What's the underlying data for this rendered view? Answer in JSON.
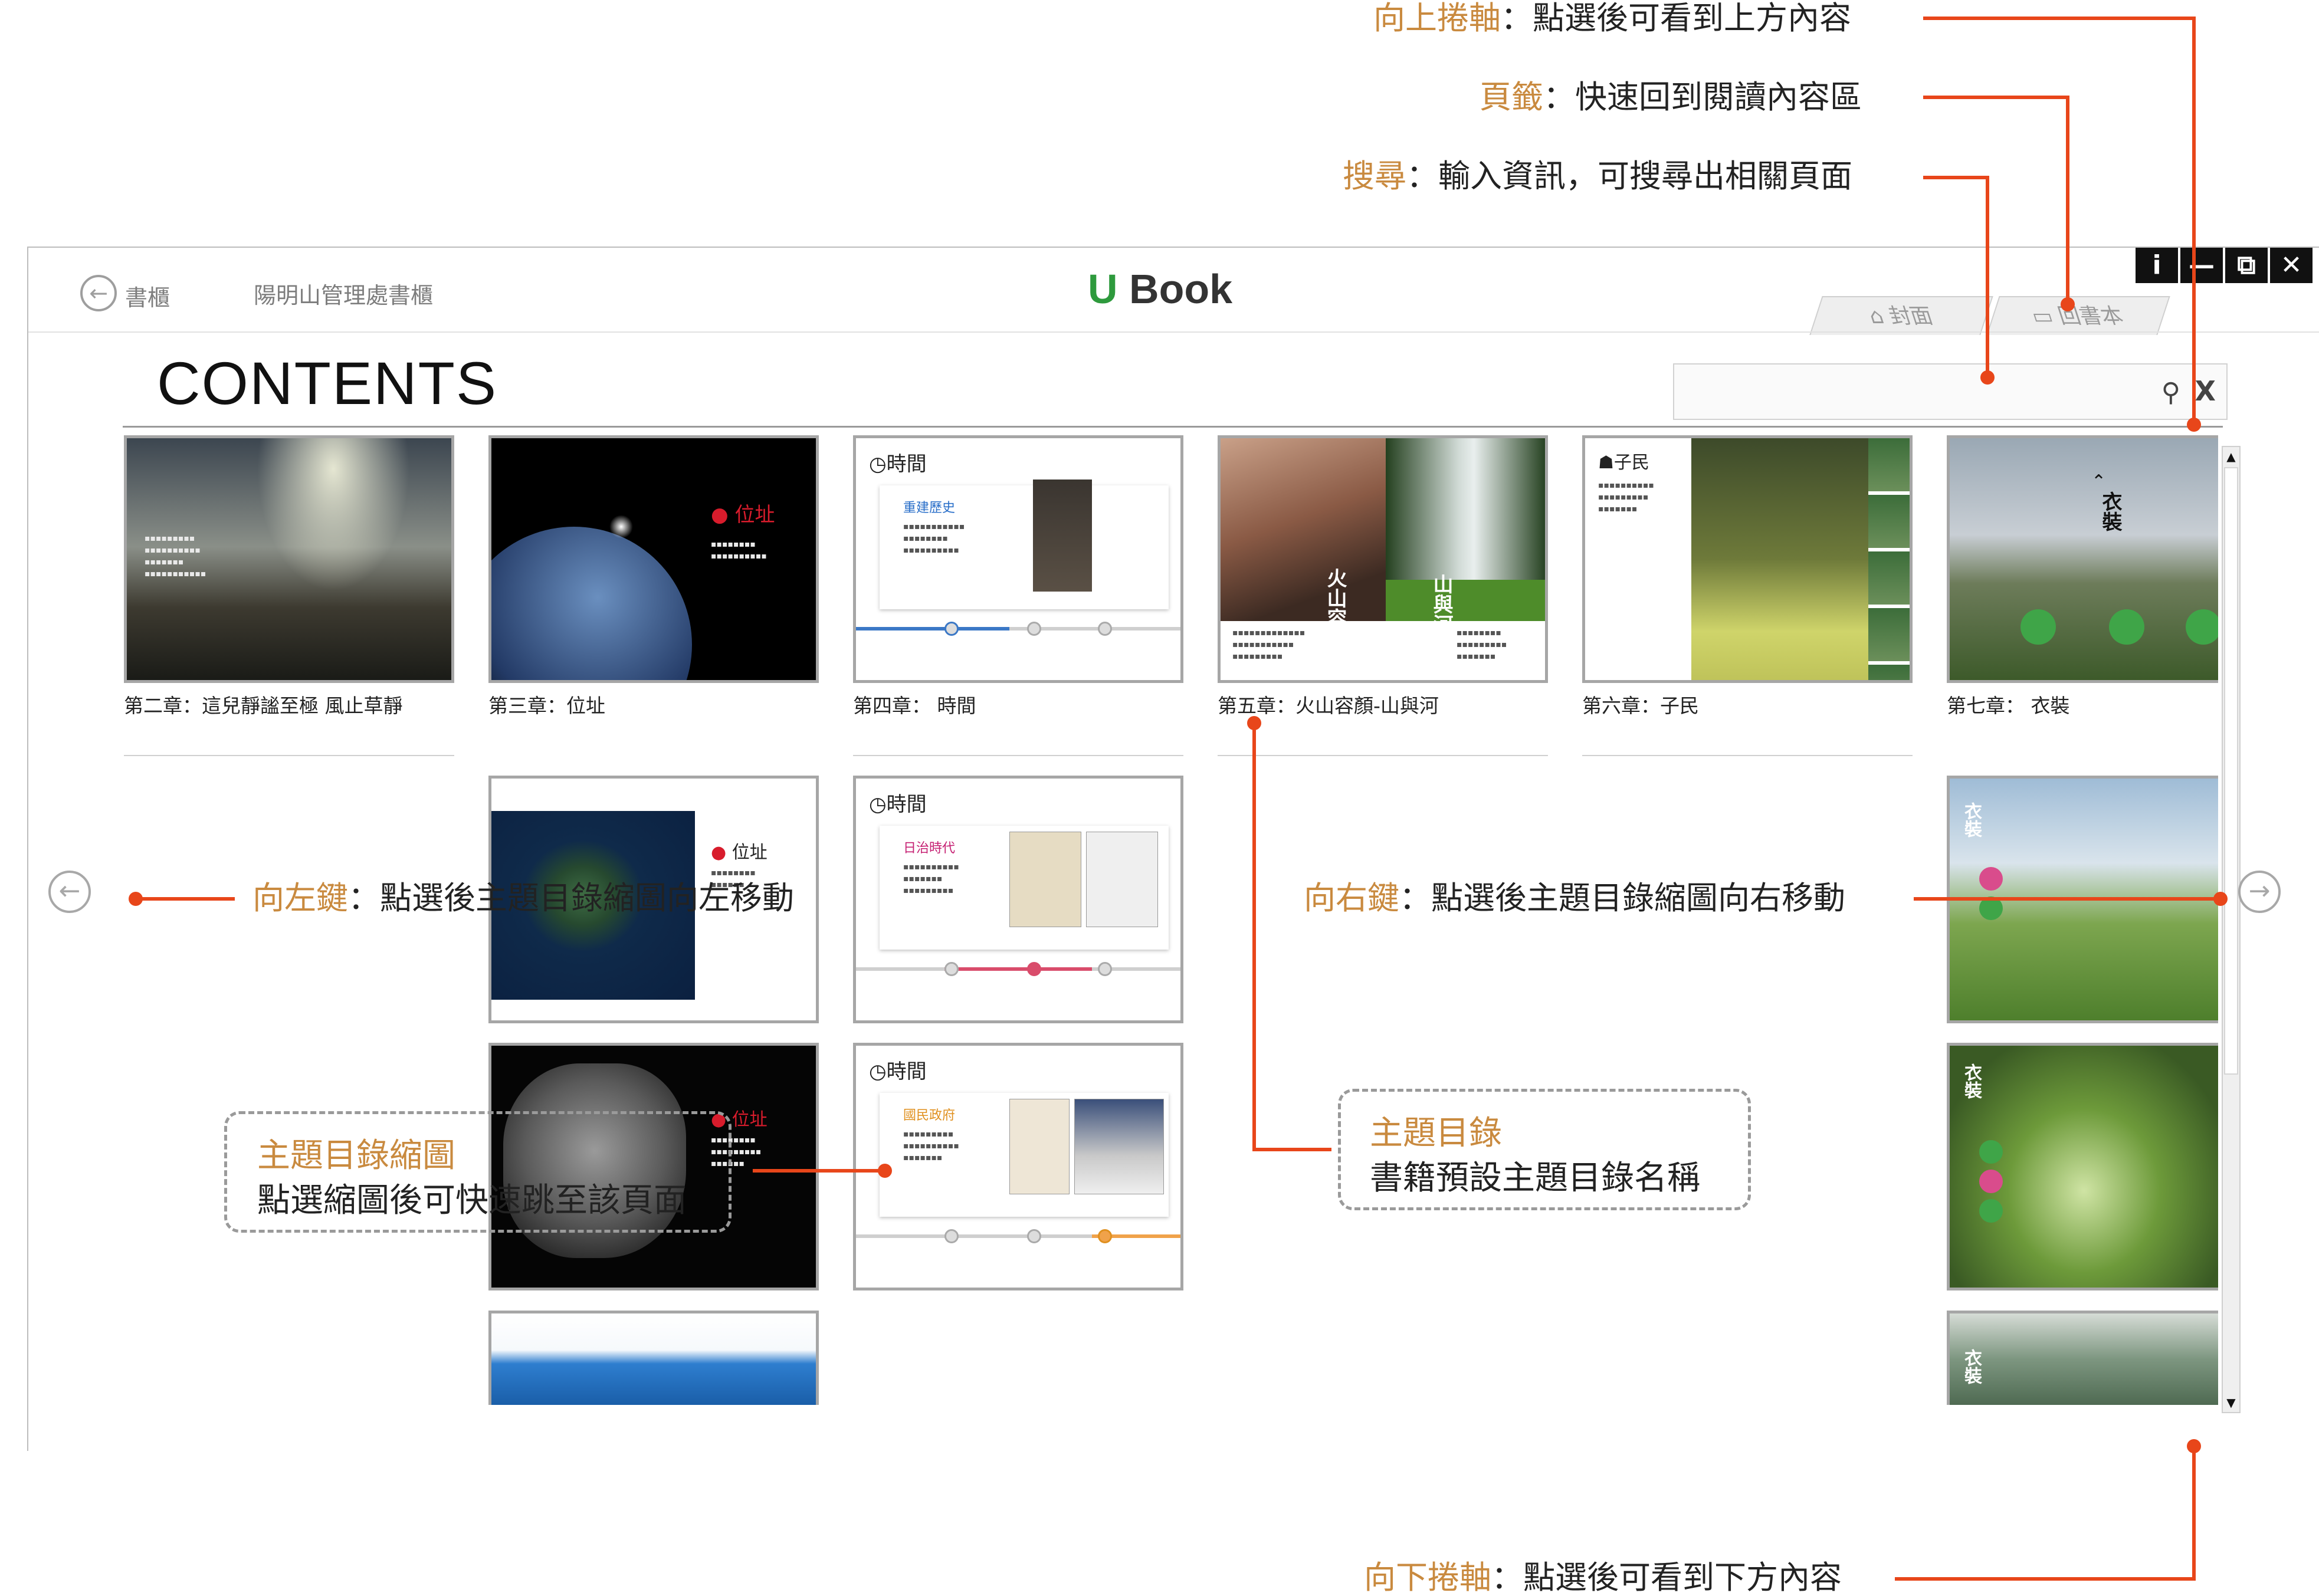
{
  "app": {
    "back_label": "書櫃",
    "shelf_name": "陽明山管理處書櫃",
    "logo_mark": "U",
    "logo_text": "Book",
    "window_controls": [
      "i",
      "—",
      "⧉",
      "✕"
    ],
    "tabs": {
      "cover": "封面",
      "back_to_book": "回書本"
    },
    "contents_heading": "CONTENTS",
    "search": {
      "value": "",
      "placeholder": ""
    }
  },
  "chapters": [
    {
      "caption": "第二章：這兒靜謐至極 風止草靜"
    },
    {
      "caption": "第三章：位址",
      "tag": "位址"
    },
    {
      "caption": "第四章： 時間",
      "tag": "時間",
      "sub": "重建歷史"
    },
    {
      "caption": "第五章：火山容顏-山與河",
      "vert1": "火山容顏",
      "vert2": "山與河"
    },
    {
      "caption": "第六章：子民",
      "tag": "子民"
    },
    {
      "caption": "第七章： 衣裝",
      "tag": "衣裝"
    }
  ],
  "subpages": {
    "taiwan_tag": "位址",
    "island_tag": "位址",
    "time_tag_a": "時間",
    "time_sub_a": "日治時代",
    "time_tag_b": "時間",
    "time_sub_b": "國民政府",
    "clothing_tag_a": "衣裝",
    "clothing_tag_b": "衣裝",
    "clothing_tag_c": "衣裝"
  },
  "annotations": {
    "scroll_up": {
      "term": "向上捲軸",
      "desc": "：點選後可看到上方內容"
    },
    "bookmark": {
      "term": "頁籤",
      "desc": "：快速回到閱讀內容區"
    },
    "search": {
      "term": "搜尋",
      "desc": "：輸入資訊，可搜尋出相關頁面"
    },
    "left_key": {
      "term": "向左鍵",
      "desc": "：點選後主題目錄縮圖向左移動"
    },
    "right_key": {
      "term": "向右鍵",
      "desc": "：點選後主題目錄縮圖向右移動"
    },
    "topic_thumbnail": {
      "term": "主題目錄縮圖",
      "desc": "點選縮圖後可快速跳至該頁面"
    },
    "topic_catalog": {
      "term": "主題目錄",
      "desc": "書籍預設主題目錄名稱"
    },
    "scroll_down": {
      "term": "向下捲軸",
      "desc": "：點選後可看到下方內容"
    }
  },
  "colors": {
    "accent": "#e8461a",
    "term": "#c98a3f",
    "logo_green": "#2e9a3d"
  },
  "icons": [
    "back-arrow-icon",
    "home-icon",
    "book-icon",
    "search-icon",
    "clear-icon",
    "left-arrow-icon",
    "right-arrow-icon",
    "scroll-up-icon",
    "scroll-down-icon",
    "location-pin-icon",
    "clock-icon",
    "people-icon",
    "mountain-icon"
  ]
}
